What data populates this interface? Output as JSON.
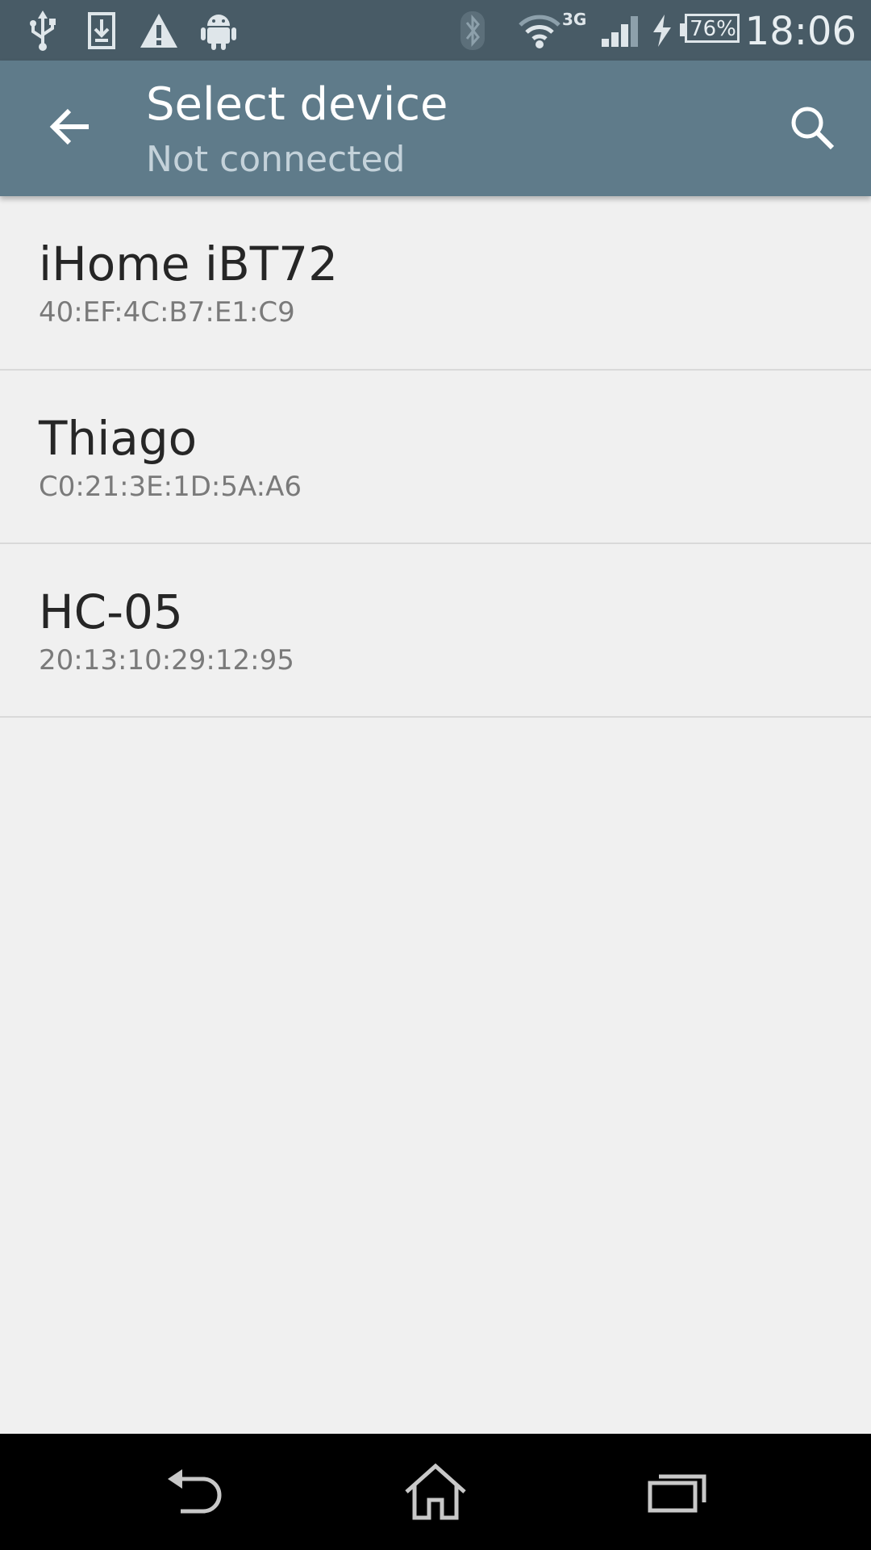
{
  "status_bar": {
    "battery_percent": "76%",
    "network_type": "3G",
    "time": "18:06",
    "icons": [
      "usb-icon",
      "download-icon",
      "warning-icon",
      "android-icon",
      "bluetooth-icon",
      "wifi-icon",
      "cell-signal-icon",
      "charging-icon",
      "battery-icon"
    ]
  },
  "app_bar": {
    "title": "Select device",
    "subtitle": "Not connected",
    "back_icon": "arrow-left-icon",
    "search_icon": "search-icon"
  },
  "devices": [
    {
      "name": "iHome iBT72",
      "address": "40:EF:4C:B7:E1:C9"
    },
    {
      "name": "Thiago",
      "address": "C0:21:3E:1D:5A:A6"
    },
    {
      "name": "HC-05",
      "address": "20:13:10:29:12:95"
    }
  ],
  "nav_bar": {
    "icons": [
      "back-icon",
      "home-icon",
      "recents-icon"
    ]
  },
  "colors": {
    "status_bar": "#485b66",
    "app_bar": "#5f7b8a",
    "background": "#f0f0f0",
    "nav_bar": "#000000"
  }
}
